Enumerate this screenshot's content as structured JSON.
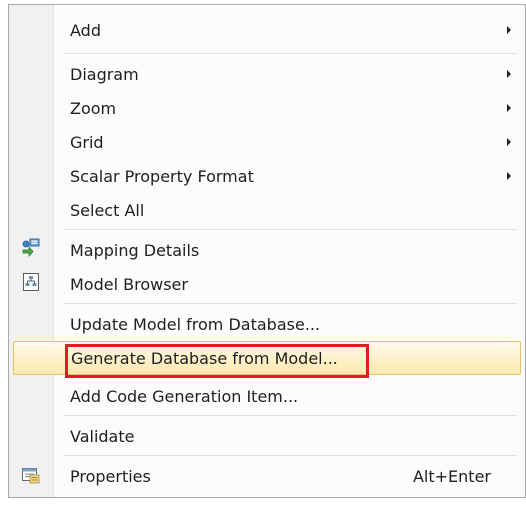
{
  "menu": {
    "items": [
      {
        "label": "Add",
        "submenu": true
      },
      {
        "label": "Diagram",
        "submenu": true
      },
      {
        "label": "Zoom",
        "submenu": true
      },
      {
        "label": "Grid",
        "submenu": true
      },
      {
        "label": "Scalar Property Format",
        "submenu": true
      },
      {
        "label": "Select All"
      },
      {
        "label": "Mapping Details",
        "icon": "mapping-details-icon"
      },
      {
        "label": "Model Browser",
        "icon": "model-browser-icon"
      },
      {
        "label": "Update Model from Database..."
      },
      {
        "label": "Generate Database from Model...",
        "highlighted": true
      },
      {
        "label": "Add Code Generation Item..."
      },
      {
        "label": "Validate"
      },
      {
        "label": "Properties",
        "shortcut": "Alt+Enter",
        "icon": "properties-icon"
      }
    ]
  },
  "colors": {
    "highlight_fill": "#fde9b0",
    "highlight_border": "#e5c365",
    "annotation_box": "#e01b24"
  }
}
